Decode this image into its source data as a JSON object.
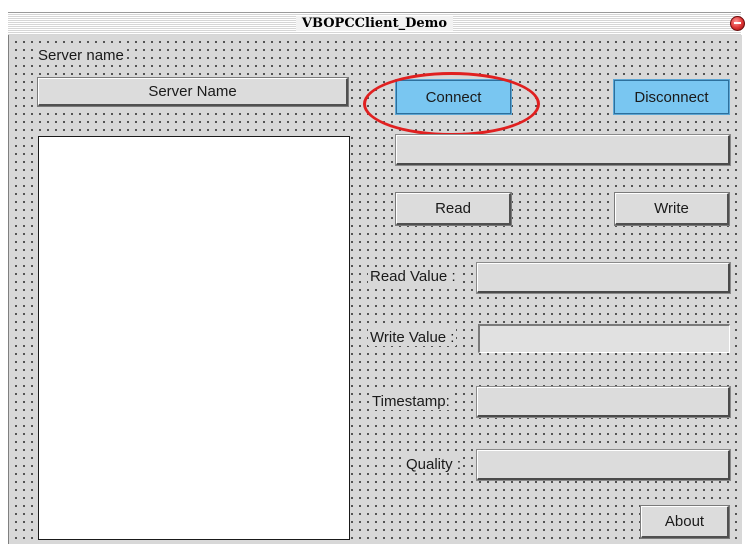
{
  "window": {
    "title": "VBOPCClient_Demo"
  },
  "labels": {
    "server_name": "Server name",
    "read_value": "Read Value :",
    "write_value": "Write Value :",
    "timestamp": "Timestamp:",
    "quality": "Quality :"
  },
  "buttons": {
    "server_name": "Server Name",
    "connect": "Connect",
    "disconnect": "Disconnect",
    "read": "Read",
    "write": "Write",
    "about": "About"
  },
  "fields": {
    "item_id": "",
    "read_value": "",
    "write_value": "",
    "timestamp": "",
    "quality": ""
  },
  "annotation": {
    "highlight_color": "#e02020",
    "highlighted": "connect-button"
  },
  "colors": {
    "connect_button_bg": "#79c6f1",
    "form_bg": "#d8d8d8"
  }
}
